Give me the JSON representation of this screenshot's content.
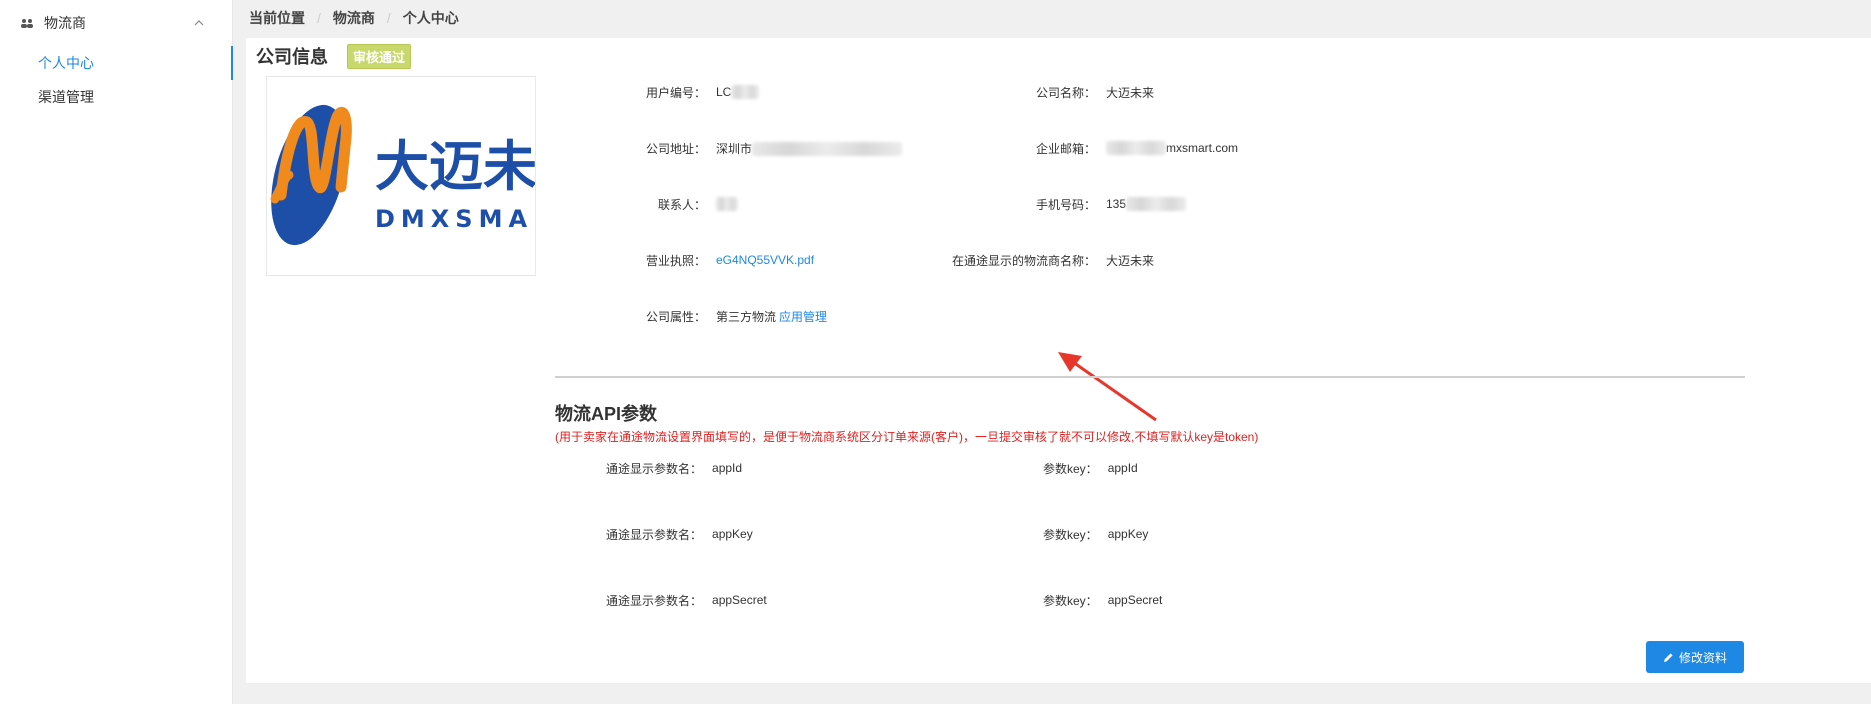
{
  "sidebar": {
    "group": {
      "label": "物流商",
      "icon": "users-icon"
    },
    "items": [
      {
        "label": "个人中心",
        "active": true
      },
      {
        "label": "渠道管理",
        "active": false
      }
    ]
  },
  "breadcrumb": {
    "items": [
      "当前位置",
      "物流商",
      "个人中心"
    ]
  },
  "company": {
    "title": "公司信息",
    "status_badge": "审核通过",
    "logo": {
      "cn_text": "大迈未来",
      "en_text": "DMXSMART"
    },
    "fields": {
      "user_id": {
        "label": "用户编号：",
        "value": "LC"
      },
      "company_name": {
        "label": "公司名称：",
        "value": "大迈未来"
      },
      "address": {
        "label": "公司地址：",
        "value": "深圳市"
      },
      "email": {
        "label": "企业邮箱：",
        "value": "mxsmart.com"
      },
      "contact": {
        "label": "联系人：",
        "value": ""
      },
      "phone": {
        "label": "手机号码：",
        "value": "135"
      },
      "license": {
        "label": "营业执照：",
        "value": "eG4NQ55VVK.pdf"
      },
      "display_name": {
        "label": "在通途显示的物流商名称：",
        "value": "大迈未来"
      },
      "attribute": {
        "label": "公司属性：",
        "value": "第三方物流",
        "link": "应用管理"
      }
    }
  },
  "api": {
    "title": "物流API参数",
    "note": "(用于卖家在通途物流设置界面填写的，是便于物流商系统区分订单来源(客户)，一旦提交审核了就不可以修改,不填写默认key是token)",
    "rows": [
      {
        "name_label": "通途显示参数名：",
        "name_value": "appId",
        "key_label": "参数key：",
        "key_value": "appId"
      },
      {
        "name_label": "通途显示参数名：",
        "name_value": "appKey",
        "key_label": "参数key：",
        "key_value": "appKey"
      },
      {
        "name_label": "通途显示参数名：",
        "name_value": "appSecret",
        "key_label": "参数key：",
        "key_value": "appSecret"
      }
    ]
  },
  "actions": {
    "edit_label": "修改资料"
  },
  "colors": {
    "accent": "#1e88e5",
    "badge": "#c8d86a",
    "note": "#e02020",
    "arrow": "#e8372a",
    "logo_blue": "#1d4ea8",
    "logo_orange": "#f08a1c"
  }
}
